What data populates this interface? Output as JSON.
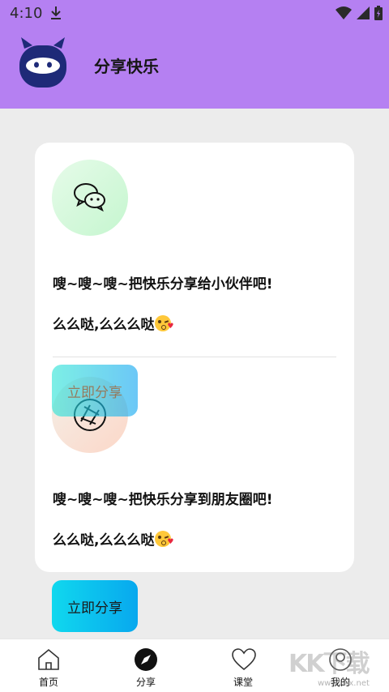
{
  "status": {
    "time": "4:10"
  },
  "app": {
    "title": "分享快乐"
  },
  "share_card": {
    "wechat": {
      "icon": "wechat-icon",
      "line1": "嗖~嗖~嗖~把快乐分享给小伙伴吧!",
      "line2": "么么哒,么么么哒"
    },
    "moments": {
      "icon": "moments-icon",
      "line1": "嗖~嗖~嗖~把快乐分享到朋友圈吧!",
      "line2": "么么哒,么么么哒"
    },
    "share_overlay_label": "立即分享"
  },
  "share_button": {
    "label": "立即分享"
  },
  "nav": {
    "items": [
      {
        "label": "首页",
        "icon": "home-icon"
      },
      {
        "label": "分享",
        "icon": "compass-icon"
      },
      {
        "label": "课堂",
        "icon": "heart-icon"
      },
      {
        "label": "我的",
        "icon": "profile-icon"
      }
    ]
  },
  "watermark": {
    "text": "KK下载",
    "url": "www.kkx.net"
  },
  "colors": {
    "header": "#b580f2",
    "accent_gradient_start": "#10d8ee",
    "accent_gradient_end": "#08a8ee"
  }
}
